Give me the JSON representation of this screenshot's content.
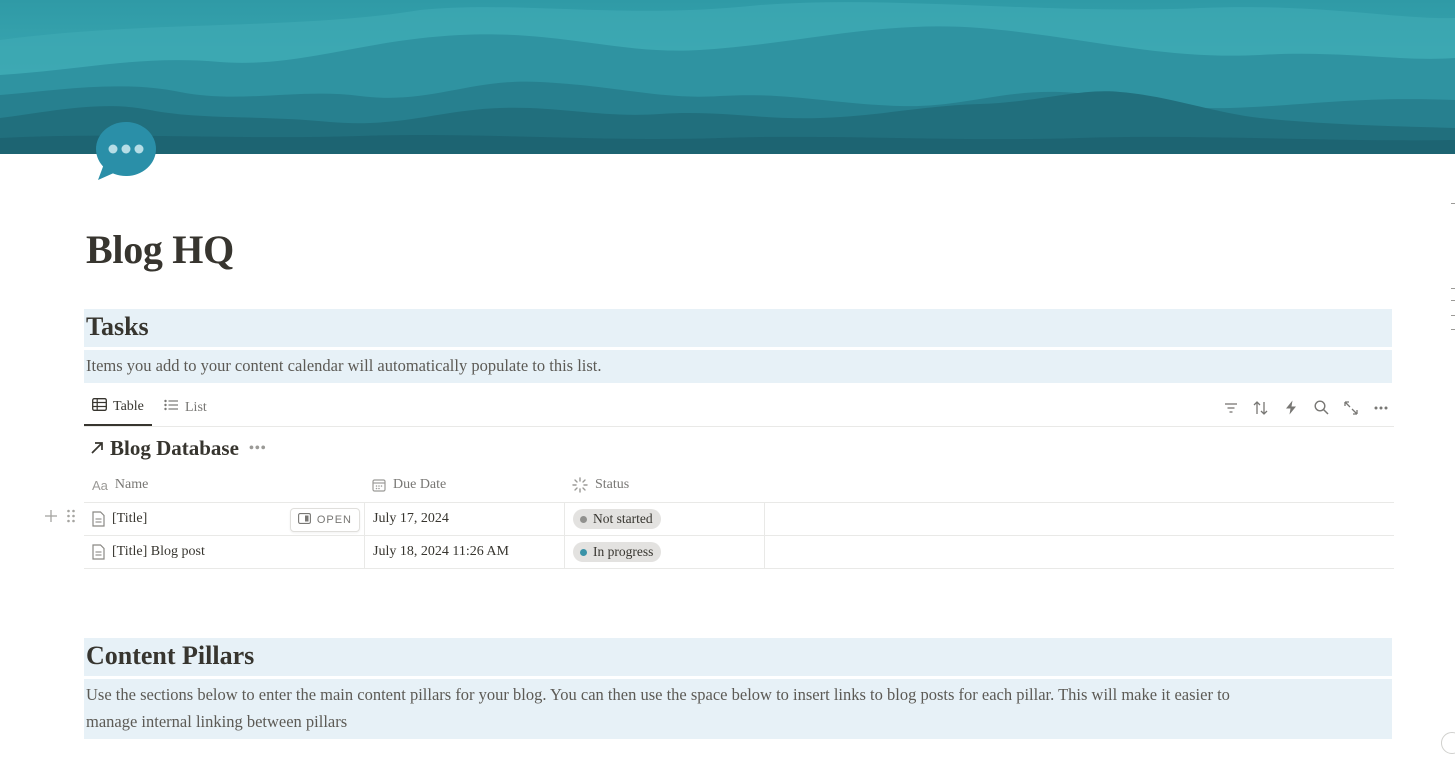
{
  "page": {
    "icon": "speech-bubble-icon",
    "title": "Blog HQ"
  },
  "tasks": {
    "heading": "Tasks",
    "description": "Items you add to your content calendar will automatically populate to this list."
  },
  "views": {
    "tabs": [
      {
        "label": "Table",
        "icon": "table-icon",
        "active": true
      },
      {
        "label": "List",
        "icon": "list-icon",
        "active": false
      }
    ],
    "tools": [
      "filter-icon",
      "sort-icon",
      "automation-icon",
      "search-icon",
      "expand-icon",
      "more-icon"
    ]
  },
  "database": {
    "title": "Blog Database",
    "columns": [
      {
        "label": "Name",
        "icon": "text-property-icon"
      },
      {
        "label": "Due Date",
        "icon": "calendar-icon"
      },
      {
        "label": "Status",
        "icon": "status-icon"
      }
    ],
    "rows": [
      {
        "name": "[Title]",
        "due": "July 17, 2024",
        "status": "Not started",
        "open_label": "OPEN"
      },
      {
        "name": "[Title] Blog post",
        "due": "July 18, 2024 11:26 AM",
        "status": "In progress"
      }
    ]
  },
  "pillars": {
    "heading": "Content Pillars",
    "description_line1": "Use the sections below to enter the main content pillars for your blog.  You can then use the space below to insert links to blog posts for each pillar.  This will make it easier to",
    "description_line2": "manage internal linking between pillars"
  },
  "colors": {
    "callout_bg": "#e7f1f7",
    "cover_sky": "#3aa9b4",
    "cover_mountain": "#216f7d",
    "icon_blue": "#2a8fa8",
    "status_not_started": "#91918e",
    "status_in_progress": "#3a93a8"
  }
}
